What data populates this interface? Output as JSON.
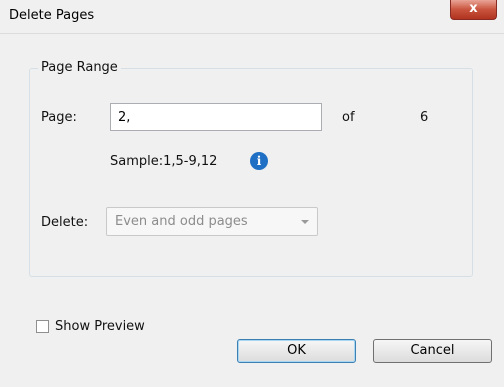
{
  "dialog": {
    "title": "Delete Pages",
    "close_label": "x"
  },
  "page_range": {
    "legend": "Page Range",
    "page_label": "Page:",
    "page_value": "2,",
    "of_label": "of",
    "total_pages": "6",
    "sample_text": "Sample:1,5-9,12",
    "delete_label": "Delete:",
    "delete_selected": "Even and odd pages"
  },
  "options": {
    "show_preview_label": "Show Preview",
    "show_preview_checked": false
  },
  "buttons": {
    "ok_label": "OK",
    "cancel_label": "Cancel"
  },
  "icons": {
    "info": "info-icon",
    "dropdown": "chevron-down-icon",
    "close": "close-icon"
  }
}
